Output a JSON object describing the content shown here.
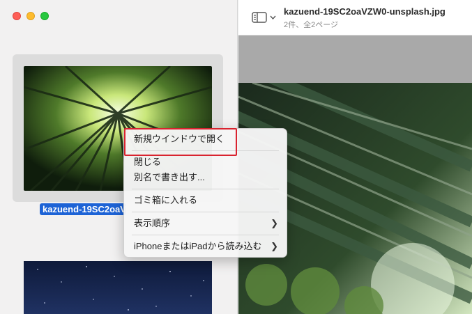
{
  "window": {
    "title": "kazuend-19SC2oaVZW0-unsplash.jpg",
    "subtitle": "2件、全2ページ"
  },
  "sidebar": {
    "thumbnail_label": "kazuend-19SC2oaVZW0-unsplash.jpg"
  },
  "context_menu": {
    "items": [
      {
        "label": "新規ウインドウで開く",
        "has_submenu": false
      },
      {
        "label": "閉じる",
        "has_submenu": false
      },
      {
        "label": "別名で書き出す...",
        "has_submenu": false
      },
      {
        "label": "ゴミ箱に入れる",
        "has_submenu": false
      },
      {
        "label": "表示順序",
        "has_submenu": true
      },
      {
        "label": "iPhoneまたはiPadから読み込む",
        "has_submenu": true
      }
    ]
  },
  "icons": {
    "submenu": "chevron-right-icon",
    "toggle": "sidebar-toggle-icon"
  },
  "colors": {
    "selection": "#1d63d6",
    "highlight_box": "#d9232f"
  }
}
